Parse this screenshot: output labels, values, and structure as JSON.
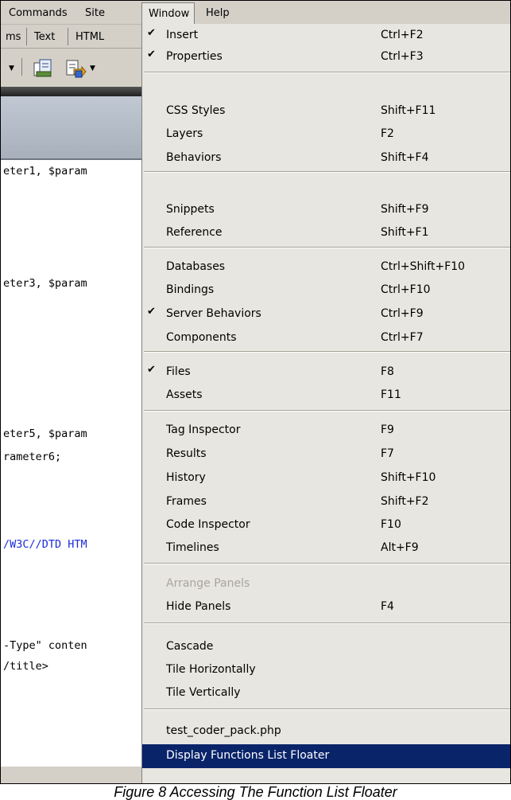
{
  "menubar": {
    "commands": "Commands",
    "site": "Site",
    "window": "Window",
    "help": "Help"
  },
  "editor": {
    "tabs": [
      "ms",
      "Text",
      "HTML"
    ],
    "code_lines": [
      {
        "text": "eter1, $param",
        "blue": false
      },
      {
        "text": "eter3, $param",
        "blue": false
      },
      {
        "text": "eter5, $param",
        "blue": false
      },
      {
        "text": "rameter6;",
        "blue": false
      },
      {
        "text": "/W3C//DTD HTM",
        "blue": true
      },
      {
        "text": "-Type\" conten",
        "blue": false
      },
      {
        "text": "/title>",
        "blue": false
      }
    ]
  },
  "window_menu": {
    "items": [
      {
        "label": "Insert",
        "shortcut": "Ctrl+F2",
        "checked": true
      },
      {
        "label": "Properties",
        "shortcut": "Ctrl+F3",
        "checked": true
      },
      {
        "label": "CSS Styles",
        "shortcut": "Shift+F11",
        "checked": false
      },
      {
        "label": "Layers",
        "shortcut": "F2",
        "checked": false
      },
      {
        "label": "Behaviors",
        "shortcut": "Shift+F4",
        "checked": false
      },
      {
        "label": "Snippets",
        "shortcut": "Shift+F9",
        "checked": false
      },
      {
        "label": "Reference",
        "shortcut": "Shift+F1",
        "checked": false
      },
      {
        "label": "Databases",
        "shortcut": "Ctrl+Shift+F10",
        "checked": false
      },
      {
        "label": "Bindings",
        "shortcut": "Ctrl+F10",
        "checked": false
      },
      {
        "label": "Server Behaviors",
        "shortcut": "Ctrl+F9",
        "checked": true
      },
      {
        "label": "Components",
        "shortcut": "Ctrl+F7",
        "checked": false
      },
      {
        "label": "Files",
        "shortcut": "F8",
        "checked": true
      },
      {
        "label": "Assets",
        "shortcut": "F11",
        "checked": false
      },
      {
        "label": "Tag Inspector",
        "shortcut": "F9",
        "checked": false
      },
      {
        "label": "Results",
        "shortcut": "F7",
        "checked": false
      },
      {
        "label": "History",
        "shortcut": "Shift+F10",
        "checked": false
      },
      {
        "label": "Frames",
        "shortcut": "Shift+F2",
        "checked": false
      },
      {
        "label": "Code Inspector",
        "shortcut": "F10",
        "checked": false
      },
      {
        "label": "Timelines",
        "shortcut": "Alt+F9",
        "checked": false
      },
      {
        "label": "Arrange Panels",
        "shortcut": "",
        "checked": false,
        "disabled": true
      },
      {
        "label": "Hide Panels",
        "shortcut": "F4",
        "checked": false
      },
      {
        "label": "Cascade",
        "shortcut": "",
        "checked": false
      },
      {
        "label": "Tile Horizontally",
        "shortcut": "",
        "checked": false
      },
      {
        "label": "Tile Vertically",
        "shortcut": "",
        "checked": false
      },
      {
        "label": "test_coder_pack.php",
        "shortcut": "",
        "checked": false
      },
      {
        "label": "Display Functions List Floater",
        "shortcut": "",
        "checked": false,
        "selected": true
      }
    ],
    "check_glyph": "✔"
  },
  "caption": "Figure 8 Accessing The Function List Floater",
  "colors": {
    "menu_bg": "#e8e6e0",
    "selection": "#0a246a",
    "code_blue": "#1a2bd8"
  }
}
